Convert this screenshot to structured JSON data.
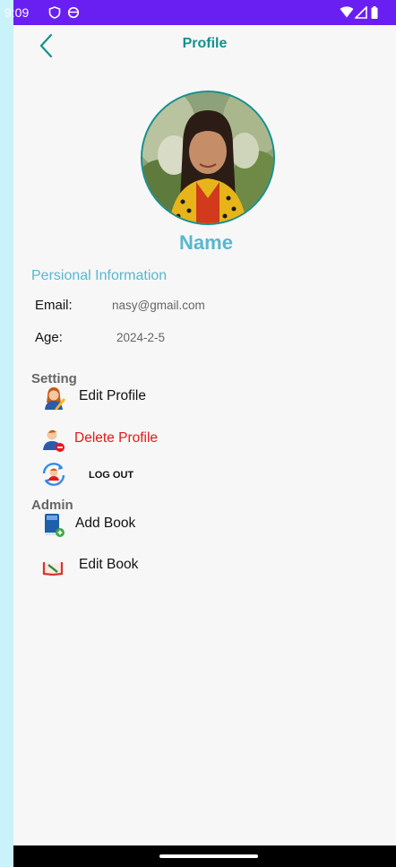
{
  "status_bar": {
    "time": "9:09"
  },
  "header": {
    "title": "Profile"
  },
  "profile": {
    "name": "Name"
  },
  "personal_info": {
    "heading": "Persional Information",
    "email_label": "Email:",
    "email_value": "nasy@gmail.com",
    "age_label": "Age:",
    "age_value": "2024-2-5"
  },
  "setting": {
    "heading": "Setting",
    "edit_profile": "Edit Profile",
    "delete_profile": "Delete Profile",
    "log_out": "LOG OUT"
  },
  "admin": {
    "heading": "Admin",
    "add_book": "Add Book",
    "edit_book": "Edit Book"
  },
  "colors": {
    "status_bar": "#6a1ff2",
    "accent_teal": "#15918f",
    "accent_blue": "#58b7cf",
    "danger_red": "#e8161c",
    "side_bg": "#c9f2fb"
  }
}
